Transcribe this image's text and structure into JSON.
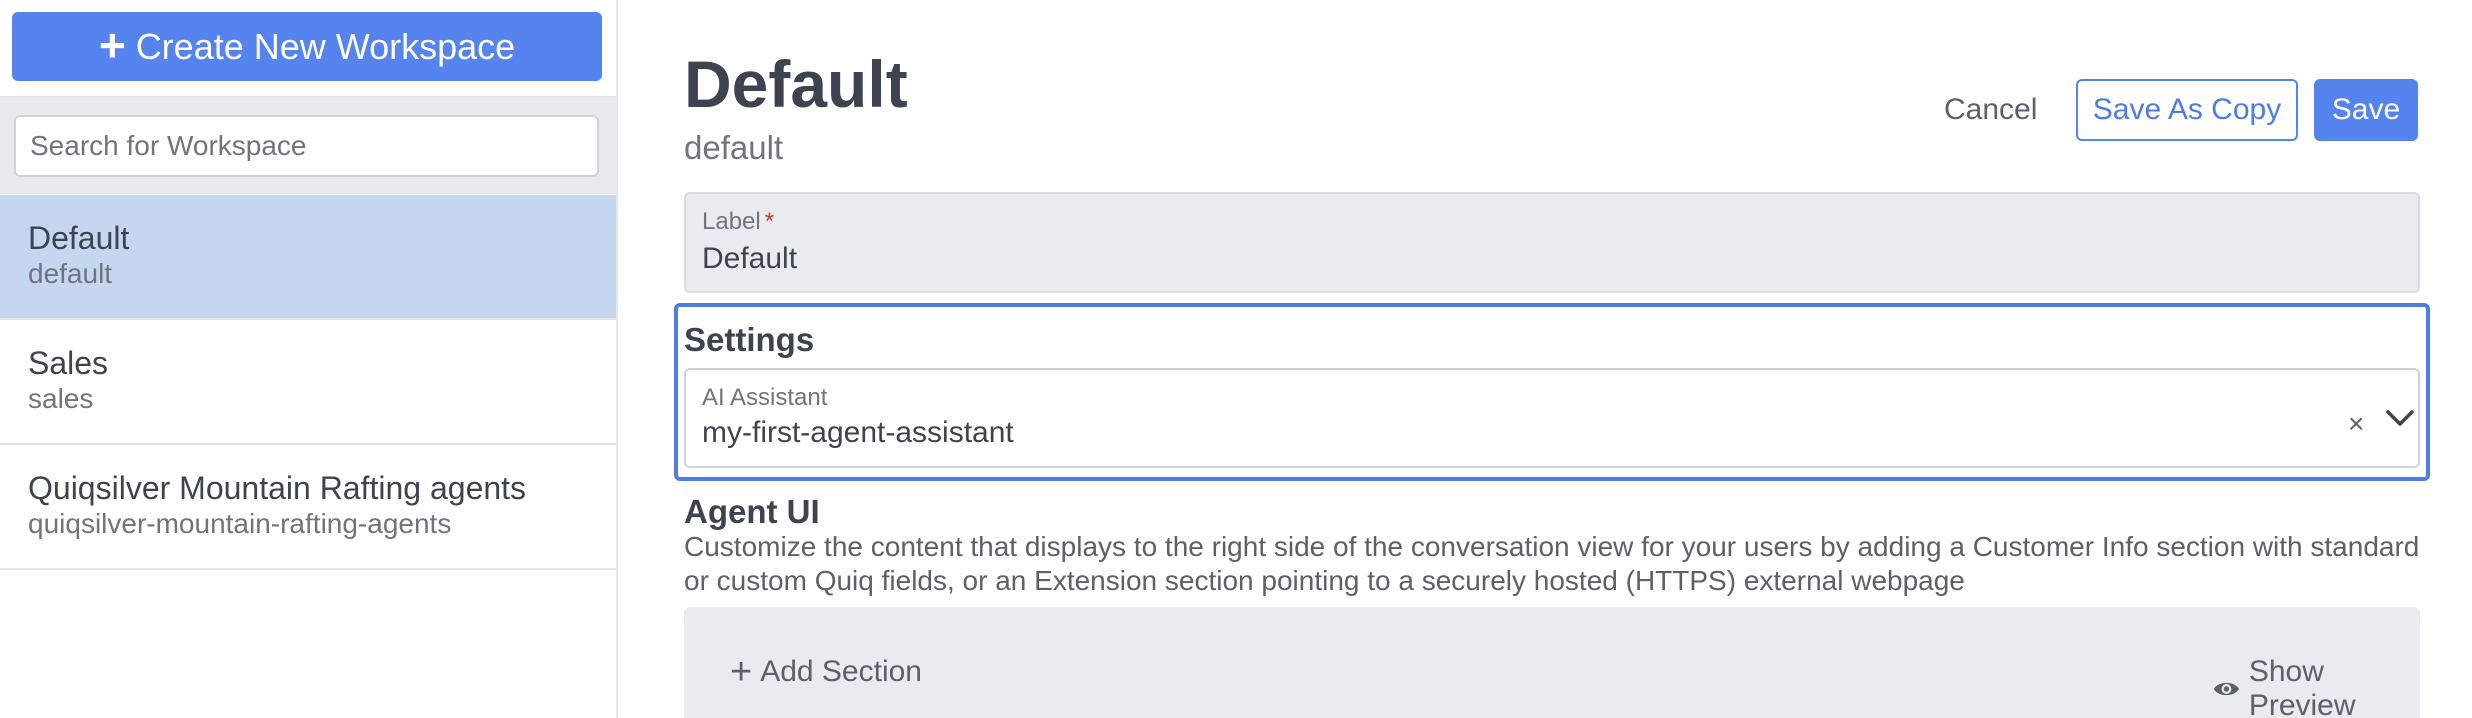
{
  "sidebar": {
    "create_label": "Create New Workspace",
    "search_placeholder": "Search for Workspace",
    "workspaces": [
      {
        "name": "Default",
        "slug": "default",
        "selected": true
      },
      {
        "name": "Sales",
        "slug": "sales",
        "selected": false
      },
      {
        "name": "Quiqsilver Mountain Rafting agents",
        "slug": "quiqsilver-mountain-rafting-agents",
        "selected": false
      }
    ]
  },
  "header": {
    "title": "Default",
    "subtitle": "default",
    "cancel_label": "Cancel",
    "save_copy_label": "Save As Copy",
    "save_label": "Save"
  },
  "label_field": {
    "caption": "Label",
    "required_mark": "*",
    "value": "Default"
  },
  "settings": {
    "title": "Settings",
    "assistant_caption": "AI Assistant",
    "assistant_value": "my-first-agent-assistant",
    "clear_symbol": "×"
  },
  "agent_ui": {
    "title": "Agent UI",
    "description": "Customize the content that displays to the right side of the conversation view for your users by adding a Customer Info section with standard or custom Quiq fields, or an Extension section pointing to a securely hosted (HTTPS) external webpage",
    "add_section_label": "Add Section",
    "show_preview_label": "Show Preview"
  },
  "colors": {
    "accent": "#5584ee",
    "selected_row": "#c5d7f0",
    "focus_border": "#4f7de6",
    "text": "#3d4350",
    "muted": "#6f7480"
  },
  "icons": {
    "create": "plus-icon",
    "dropdown": "chevron-down-icon",
    "clear": "close-icon",
    "add_section": "plus-icon",
    "preview": "eye-icon"
  }
}
